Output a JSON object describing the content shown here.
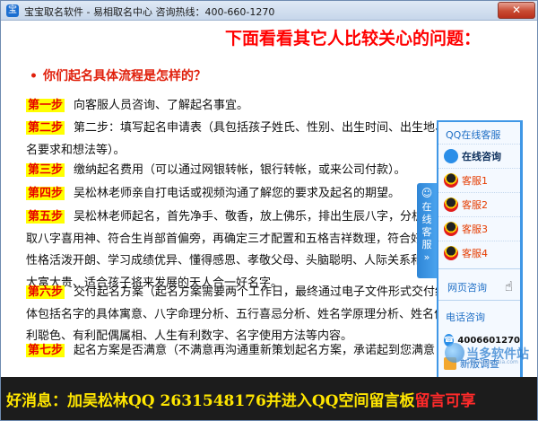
{
  "window": {
    "title": "宝宝取名软件 - 易相取名中心 咨询热线：400-660-1270",
    "close_label": "✕"
  },
  "content": {
    "headline": "下面看看其它人比较关心的问题：",
    "question": "你们起名具体流程是怎样的？",
    "question_bullet": "•",
    "steps": [
      {
        "label": "第一步",
        "lines": [
          "向客服人员咨询、了解起名事宜。"
        ]
      },
      {
        "label": "第二步",
        "lines": [
          "第二步：填写起名申请表（具包括孩子姓氏、性别、出生时间、出生地、",
          "名要求和想法等）。"
        ]
      },
      {
        "label": "第三步",
        "lines": [
          "缴纳起名费用（可以通过网银转帐，银行转帐，或来公司付款）。"
        ]
      },
      {
        "label": "第四步",
        "lines": [
          "吴松林老师亲自打电话或视频沟通了解您的要求及起名的期望。"
        ]
      },
      {
        "label": "第五步",
        "lines": [
          "吴松林老师起名，首先净手、敬香，放上佛乐，排出生辰八字，分析",
          "取八字喜用神、符合生肖部首偏旁，再确定三才配置和五格吉祥数理，符合好名",
          "性格活泼开朗、学习成绩优异、懂得感恩、孝敬父母、头脑聪明、人际关系和谐",
          "大富大贵、适合孩子将来发展的天人合一好名字。"
        ]
      },
      {
        "label": "第六步",
        "lines": [
          "交付起名方案（起名方案需要两个工作日，最终通过电子文件形式交付给",
          "体包括名字的具体寓意、八字命理分析、五行喜忌分析、姓名学原理分析、姓名作",
          "利聪色、有利配偶属相、人生有利数字、名字使用方法等内容。"
        ]
      },
      {
        "label": "第七步",
        "lines": [
          "起名方案是否满意（不满意再沟通重新策划起名方案，承诺起到您满意"
        ]
      }
    ]
  },
  "service_panel": {
    "tab_chars": [
      "在",
      "线",
      "客",
      "服"
    ],
    "tab_arrow": "»",
    "title": "QQ在线客服",
    "online_consult": "在线咨询",
    "agents": [
      "客服1",
      "客服2",
      "客服3",
      "客服4"
    ],
    "web_consult": "网页咨询",
    "phone_title": "电话咨询",
    "phone_number": "4006601270",
    "survey": "新版调查"
  },
  "watermark": {
    "text": "当多软件站",
    "sub": "www.downxia.com"
  },
  "banner": {
    "part1": "好消息：加吴松林QQ ",
    "part2": "2631548176",
    "part3": "并进入",
    "part4": "QQ空间留言板",
    "part5": "留言可享"
  },
  "colors": {
    "headline": "#ff0000",
    "step_highlight": "#ffff00",
    "panel_border": "#3f97e6",
    "banner_bg": "#1c1c1c"
  }
}
